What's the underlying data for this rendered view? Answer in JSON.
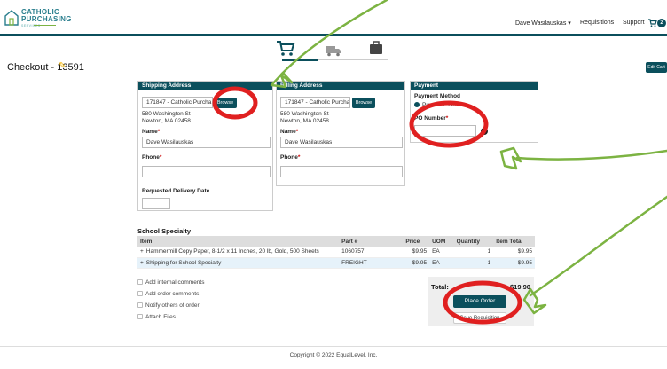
{
  "brand": {
    "line1": "CATHOLIC",
    "line2": "PURCHASING",
    "line3": "SERVICES"
  },
  "nav": {
    "user": "Dave Wasilauskas",
    "requisitions": "Requisitions",
    "support": "Support",
    "cart_count": "2"
  },
  "page": {
    "title": "Checkout - 13591",
    "edit_cart": "Edit Cart"
  },
  "progress": {
    "current_step": 1,
    "total_steps": 3
  },
  "shipping": {
    "header": "Shipping Address",
    "address_select": "171847 - Catholic Purcha",
    "browse": "Browse",
    "address_lines": [
      "580 Washington St",
      "Newton, MA 02458"
    ],
    "name_label": "Name",
    "name_value": "Dave Wasilauskas",
    "phone_label": "Phone",
    "phone_value": "",
    "delivery_label": "Requested Delivery Date",
    "delivery_value": ""
  },
  "billing": {
    "header": "Billing Address",
    "address_select": "171847 - Catholic Purcha",
    "browse": "Browse",
    "address_lines": [
      "580 Washington St",
      "Newton, MA 02458"
    ],
    "name_label": "Name",
    "name_value": "Dave Wasilauskas",
    "phone_label": "Phone",
    "phone_value": ""
  },
  "payment": {
    "header": "Payment",
    "method_label": "Payment Method",
    "method_option": "Purchase Order",
    "po_label": "PO Number",
    "po_value": ""
  },
  "vendor": {
    "name": "School Specialty",
    "columns": [
      "Item",
      "Part #",
      "Price",
      "UOM",
      "Quantity",
      "Item Total"
    ],
    "rows": [
      {
        "item": "Hammermill Copy Paper, 8-1/2 x 11 Inches, 20 lb, Gold, 500 Sheets",
        "part": "1060757",
        "price": "$9.95",
        "uom": "EA",
        "qty": "1",
        "total": "$9.95"
      },
      {
        "item": "Shipping for School Specialty",
        "part": "FREIGHT",
        "price": "$9.95",
        "uom": "EA",
        "qty": "1",
        "total": "$9.95"
      }
    ]
  },
  "options": [
    "Add internal comments",
    "Add order comments",
    "Notify others of order",
    "Attach Files"
  ],
  "totals": {
    "label": "Total:",
    "value": "$19.90",
    "place_order": "Place Order",
    "save_requisition": "Save Requisition"
  },
  "footer": {
    "copyright": "Copyright © 2022 EqualLevel, Inc."
  },
  "colors": {
    "primary": "#0b4f5c",
    "accent": "#7cb342",
    "annotation_red": "#e02020"
  }
}
